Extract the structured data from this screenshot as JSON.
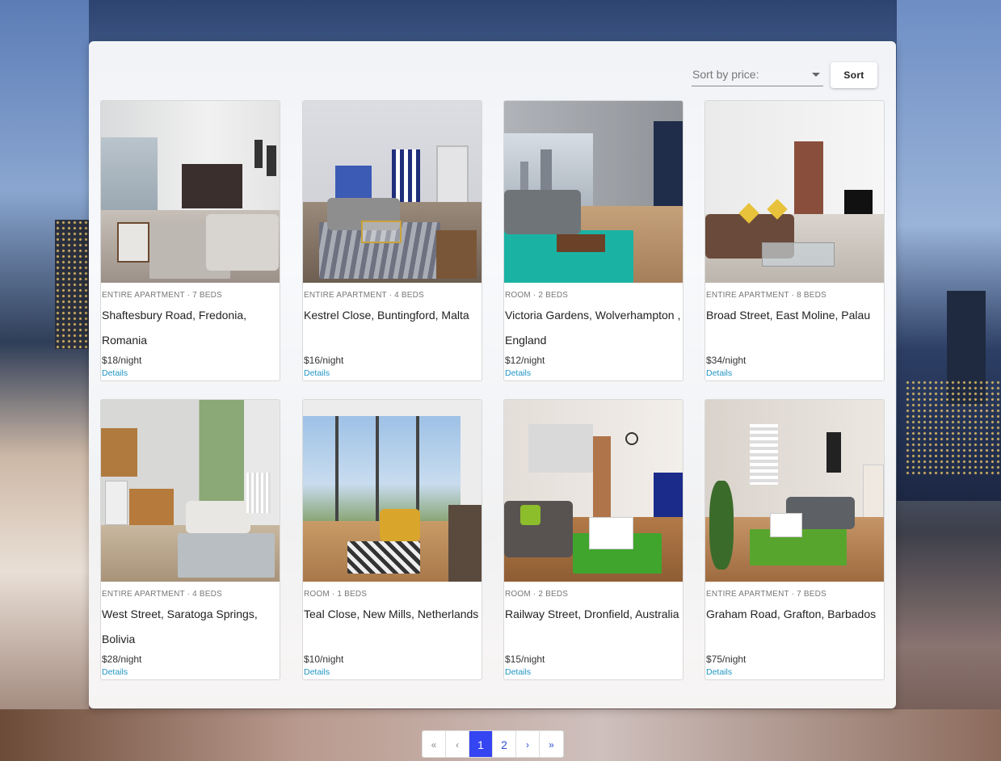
{
  "sort": {
    "placeholder": "Sort by price:",
    "button_label": "Sort"
  },
  "listings": [
    {
      "meta": "ENTIRE APARTMENT · 7 BEDS",
      "title": "Shaftesbury Road, Fredonia, Romania",
      "price": "$18/night",
      "details": "Details"
    },
    {
      "meta": "ENTIRE APARTMENT · 4 BEDS",
      "title": "Kestrel Close, Buntingford, Malta",
      "price": "$16/night",
      "details": "Details"
    },
    {
      "meta": "ROOM · 2 BEDS",
      "title": "Victoria Gardens, Wolverhampton , England",
      "price": "$12/night",
      "details": "Details"
    },
    {
      "meta": "ENTIRE APARTMENT · 8 BEDS",
      "title": "Broad Street, East Moline, Palau",
      "price": "$34/night",
      "details": "Details"
    },
    {
      "meta": "ENTIRE APARTMENT · 4 BEDS",
      "title": "West Street, Saratoga Springs, Bolivia",
      "price": "$28/night",
      "details": "Details"
    },
    {
      "meta": "ROOM · 1 BEDS",
      "title": "Teal Close, New Mills, Netherlands",
      "price": "$10/night",
      "details": "Details"
    },
    {
      "meta": "ROOM · 2 BEDS",
      "title": "Railway Street, Dronfield, Australia",
      "price": "$15/night",
      "details": "Details"
    },
    {
      "meta": "ENTIRE APARTMENT · 7 BEDS",
      "title": "Graham Road, Grafton, Barbados",
      "price": "$75/night",
      "details": "Details"
    }
  ],
  "pagination": {
    "first": "«",
    "prev": "‹",
    "pages": [
      "1",
      "2"
    ],
    "current": "1",
    "next": "›",
    "last": "»"
  }
}
